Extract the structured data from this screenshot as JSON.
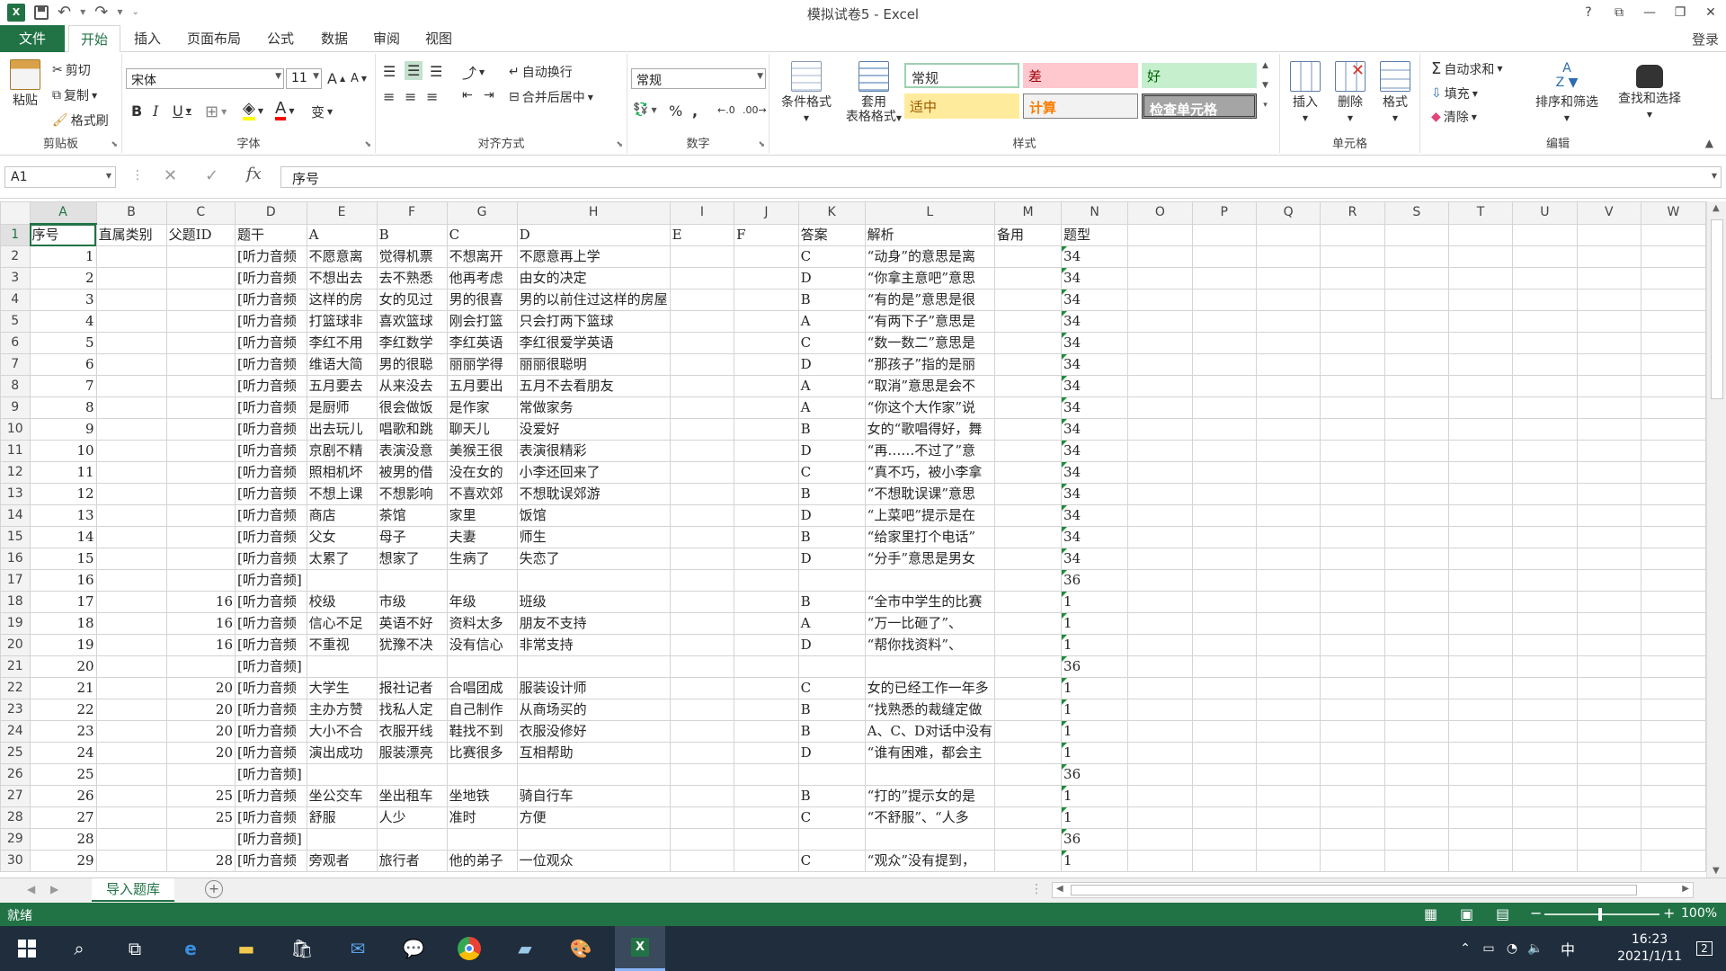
{
  "window": {
    "title": "模拟试卷5 - Excel",
    "login": "登录",
    "help": "?"
  },
  "tabs": [
    "文件",
    "开始",
    "插入",
    "页面布局",
    "公式",
    "数据",
    "审阅",
    "视图"
  ],
  "clipboard": {
    "paste": "粘贴",
    "cut": "剪切",
    "copy": "复制",
    "format_painter": "格式刷",
    "label": "剪贴板"
  },
  "font": {
    "name": "宋体",
    "size": "11",
    "label": "字体"
  },
  "alignment": {
    "wrap": "自动换行",
    "merge": "合并后居中",
    "label": "对齐方式"
  },
  "number": {
    "format": "常规",
    "label": "数字"
  },
  "styles": {
    "conditional": "条件格式",
    "table_a": "套用",
    "table_b": "表格格式",
    "normal": "常规",
    "bad": "差",
    "good": "好",
    "neutral": "适中",
    "calc": "计算",
    "check": "检查单元格",
    "label": "样式"
  },
  "cells": {
    "insert": "插入",
    "delete": "删除",
    "format": "格式",
    "label": "单元格"
  },
  "editing": {
    "autosum": "自动求和",
    "fill": "填充",
    "clear": "清除",
    "sort": "排序和筛选",
    "find": "查找和选择",
    "label": "编辑"
  },
  "formula_bar": {
    "name_box": "A1",
    "content": "序号"
  },
  "columns": [
    "A",
    "B",
    "C",
    "D",
    "E",
    "F",
    "G",
    "H",
    "I",
    "J",
    "K",
    "L",
    "M",
    "N",
    "O",
    "P",
    "Q",
    "R",
    "S",
    "T",
    "U",
    "V",
    "W"
  ],
  "header_row": [
    "序号",
    "直属类别",
    "父题ID",
    "题干",
    "A",
    "B",
    "C",
    "D",
    "E",
    "F",
    "答案",
    "解析",
    "备用",
    "题型"
  ],
  "rows": [
    [
      "1",
      "",
      "",
      "[听力音频",
      "不愿意离",
      "觉得机票",
      "不想离开",
      "不愿意再上学",
      "",
      "",
      "C",
      "“动身”的意思是离",
      "",
      "34"
    ],
    [
      "2",
      "",
      "",
      "[听力音频",
      "不想出去",
      "去不熟悉",
      "他再考虑",
      "由女的决定",
      "",
      "",
      "D",
      "“你拿主意吧”意思",
      "",
      "34"
    ],
    [
      "3",
      "",
      "",
      "[听力音频",
      "这样的房",
      "女的见过",
      "男的很喜",
      "男的以前住过这样的房屋",
      "",
      "",
      "B",
      "“有的是”意思是很",
      "",
      "34"
    ],
    [
      "4",
      "",
      "",
      "[听力音频",
      "打篮球非",
      "喜欢篮球",
      "刚会打篮",
      "只会打两下篮球",
      "",
      "",
      "A",
      "“有两下子”意思是",
      "",
      "34"
    ],
    [
      "5",
      "",
      "",
      "[听力音频",
      "李红不用",
      "李红数学",
      "李红英语",
      "李红很爱学英语",
      "",
      "",
      "C",
      "“数一数二”意思是",
      "",
      "34"
    ],
    [
      "6",
      "",
      "",
      "[听力音频",
      "维语大简",
      "男的很聪",
      "丽丽学得",
      "丽丽很聪明",
      "",
      "",
      "D",
      "“那孩子”指的是丽",
      "",
      "34"
    ],
    [
      "7",
      "",
      "",
      "[听力音频",
      "五月要去",
      "从来没去",
      "五月要出",
      "五月不去看朋友",
      "",
      "",
      "A",
      "“取消”意思是会不",
      "",
      "34"
    ],
    [
      "8",
      "",
      "",
      "[听力音频",
      "是厨师",
      "很会做饭",
      "是作家",
      "常做家务",
      "",
      "",
      "A",
      "“你这个大作家”说",
      "",
      "34"
    ],
    [
      "9",
      "",
      "",
      "[听力音频",
      "出去玩儿",
      "唱歌和跳",
      "聊天儿",
      "没爱好",
      "",
      "",
      "B",
      "女的“歌唱得好，舞",
      "",
      "34"
    ],
    [
      "10",
      "",
      "",
      "[听力音频",
      "京剧不精",
      "表演没意",
      "美猴王很",
      "表演很精彩",
      "",
      "",
      "D",
      "“再……不过了”意",
      "",
      "34"
    ],
    [
      "11",
      "",
      "",
      "[听力音频",
      "照相机坏",
      "被男的借",
      "没在女的",
      "小李还回来了",
      "",
      "",
      "C",
      "“真不巧，被小李拿",
      "",
      "34"
    ],
    [
      "12",
      "",
      "",
      "[听力音频",
      "不想上课",
      "不想影响",
      "不喜欢郊",
      "不想耽误郊游",
      "",
      "",
      "B",
      "“不想耽误课”意思",
      "",
      "34"
    ],
    [
      "13",
      "",
      "",
      "[听力音频",
      "商店",
      "茶馆",
      "家里",
      "饭馆",
      "",
      "",
      "D",
      "“上菜吧”提示是在",
      "",
      "34"
    ],
    [
      "14",
      "",
      "",
      "[听力音频",
      "父女",
      "母子",
      "夫妻",
      "师生",
      "",
      "",
      "B",
      "“给家里打个电话”",
      "",
      "34"
    ],
    [
      "15",
      "",
      "",
      "[听力音频",
      "太累了",
      "想家了",
      "生病了",
      "失恋了",
      "",
      "",
      "D",
      "“分手”意思是男女",
      "",
      "34"
    ],
    [
      "16",
      "",
      "",
      "[听力音频]",
      "",
      "",
      "",
      "",
      "",
      "",
      "",
      "",
      "",
      "36"
    ],
    [
      "17",
      "",
      "16",
      "[听力音频",
      "校级",
      "市级",
      "年级",
      "班级",
      "",
      "",
      "B",
      "“全市中学生的比赛",
      "",
      "1"
    ],
    [
      "18",
      "",
      "16",
      "[听力音频",
      "信心不足",
      "英语不好",
      "资料太多",
      "朋友不支持",
      "",
      "",
      "A",
      "“万一比砸了”、",
      "",
      "1"
    ],
    [
      "19",
      "",
      "16",
      "[听力音频",
      "不重视",
      "犹豫不决",
      "没有信心",
      "非常支持",
      "",
      "",
      "D",
      "“帮你找资料”、",
      "",
      "1"
    ],
    [
      "20",
      "",
      "",
      "[听力音频]",
      "",
      "",
      "",
      "",
      "",
      "",
      "",
      "",
      "",
      "36"
    ],
    [
      "21",
      "",
      "20",
      "[听力音频",
      "大学生",
      "报社记者",
      "合唱团成",
      "服装设计师",
      "",
      "",
      "C",
      "女的已经工作一年多",
      "",
      "1"
    ],
    [
      "22",
      "",
      "20",
      "[听力音频",
      "主办方赞",
      "找私人定",
      "自己制作",
      "从商场买的",
      "",
      "",
      "B",
      "“找熟悉的裁缝定做",
      "",
      "1"
    ],
    [
      "23",
      "",
      "20",
      "[听力音频",
      "大小不合",
      "衣服开线",
      "鞋找不到",
      "衣服没修好",
      "",
      "",
      "B",
      "A、C、D对话中没有",
      "",
      "1"
    ],
    [
      "24",
      "",
      "20",
      "[听力音频",
      "演出成功",
      "服装漂亮",
      "比赛很多",
      "互相帮助",
      "",
      "",
      "D",
      "“谁有困难，都会主",
      "",
      "1"
    ],
    [
      "25",
      "",
      "",
      "[听力音频]",
      "",
      "",
      "",
      "",
      "",
      "",
      "",
      "",
      "",
      "36"
    ],
    [
      "26",
      "",
      "25",
      "[听力音频",
      "坐公交车",
      "坐出租车",
      "坐地铁",
      "骑自行车",
      "",
      "",
      "B",
      "“打的”提示女的是",
      "",
      "1"
    ],
    [
      "27",
      "",
      "25",
      "[听力音频",
      "舒服",
      "人少",
      "准时",
      "方便",
      "",
      "",
      "C",
      "“不舒服”、“人多",
      "",
      "1"
    ],
    [
      "28",
      "",
      "",
      "[听力音频]",
      "",
      "",
      "",
      "",
      "",
      "",
      "",
      "",
      "",
      "36"
    ],
    [
      "29",
      "",
      "28",
      "[听力音频",
      "旁观者",
      "旅行者",
      "他的弟子",
      "一位观众",
      "",
      "",
      "C",
      "“观众”没有提到，",
      "",
      "1"
    ]
  ],
  "sheet_tab": "导入题库",
  "status": {
    "ready": "就绪",
    "zoom": "100%"
  },
  "clock": {
    "time": "16:23",
    "date": "2021/1/11",
    "ime": "中",
    "notif": "2"
  }
}
